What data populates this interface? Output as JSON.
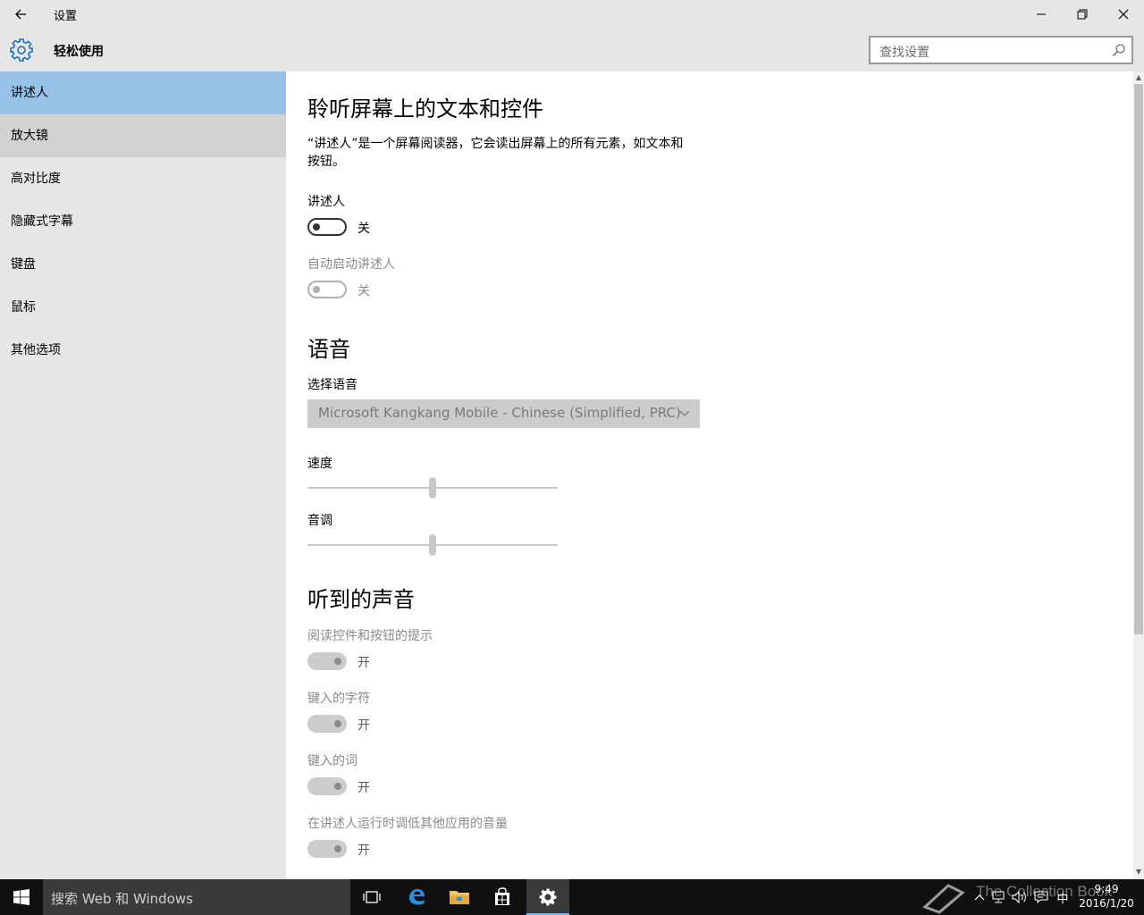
{
  "window": {
    "title": "设置",
    "back_icon": "arrow-left",
    "minimize_icon": "minimize",
    "restore_icon": "restore",
    "close_icon": "close"
  },
  "header": {
    "title": "轻松使用",
    "icon": "gear",
    "search_placeholder": "查找设置",
    "accent": "#1e6fc2"
  },
  "sidebar": {
    "items": [
      {
        "label": "讲述人",
        "state": "selected"
      },
      {
        "label": "放大镜",
        "state": "hover"
      },
      {
        "label": "高对比度",
        "state": "normal"
      },
      {
        "label": "隐藏式字幕",
        "state": "normal"
      },
      {
        "label": "键盘",
        "state": "normal"
      },
      {
        "label": "鼠标",
        "state": "normal"
      },
      {
        "label": "其他选项",
        "state": "normal"
      }
    ],
    "selected_color": "#95c2e6"
  },
  "main": {
    "section1": {
      "heading": "聆听屏幕上的文本和控件",
      "description_line1": "“讲述人”是一个屏幕阅读器，它会读出屏幕上的所有元素，如文本和",
      "description_line2": "按钮。",
      "narrator": {
        "label": "讲述人",
        "state_text": "关",
        "on": false,
        "enabled": true
      },
      "autostart": {
        "label": "自动启动讲述人",
        "state_text": "关",
        "on": false,
        "enabled": false
      }
    },
    "section2": {
      "heading": "语音",
      "voice_label": "选择语音",
      "voice_value": "Microsoft Kangkang Mobile - Chinese (Simplified, PRC)",
      "speed": {
        "label": "速度",
        "level": 0.5
      },
      "pitch": {
        "label": "音调",
        "level": 0.5
      }
    },
    "section3": {
      "heading": "听到的声音",
      "toggles": [
        {
          "label": "阅读控件和按钮的提示",
          "state_text": "开",
          "on": true,
          "enabled": false
        },
        {
          "label": "键入的字符",
          "state_text": "开",
          "on": true,
          "enabled": false
        },
        {
          "label": "键入的词",
          "state_text": "开",
          "on": true,
          "enabled": false
        },
        {
          "label": "在讲述人运行时调低其他应用的音量",
          "state_text": "开",
          "on": true,
          "enabled": false
        }
      ]
    }
  },
  "taskbar": {
    "search_placeholder": "搜索 Web 和 Windows",
    "apps": [
      "task-view",
      "edge",
      "file-explorer",
      "store",
      "settings"
    ],
    "active_app": "settings",
    "ime": "中",
    "time": "9:49",
    "date": "2016/1/20",
    "watermark": "The Collection Book"
  }
}
